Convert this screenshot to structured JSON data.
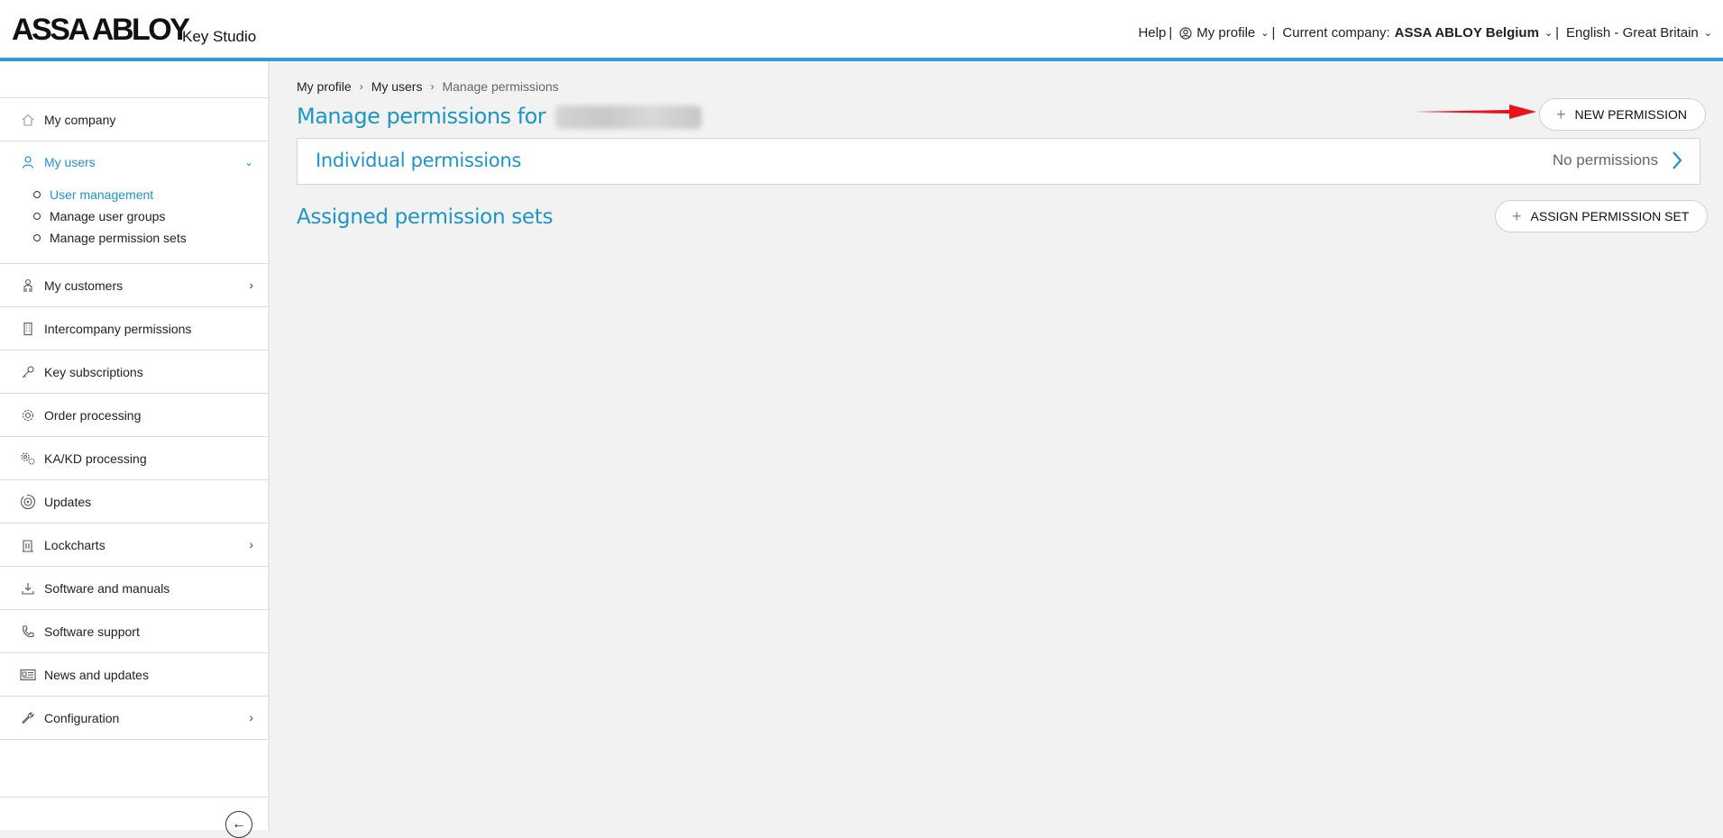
{
  "header": {
    "logo": "ASSA ABLOY",
    "product": "Key Studio",
    "help": "Help",
    "my_profile": "My profile",
    "company_label": "Current company:",
    "company_value": "ASSA ABLOY Belgium",
    "language": "English - Great Britain",
    "separator": "|"
  },
  "sidebar": {
    "items": [
      {
        "label": "My company",
        "icon": "home-icon"
      },
      {
        "label": "My users",
        "icon": "user-icon"
      },
      {
        "label": "My customers",
        "icon": "customer-icon"
      },
      {
        "label": "Intercompany permissions",
        "icon": "building-icon"
      },
      {
        "label": "Key subscriptions",
        "icon": "key-icon"
      },
      {
        "label": "Order processing",
        "icon": "gear-icon"
      },
      {
        "label": "KA/KD processing",
        "icon": "gears-icon"
      },
      {
        "label": "Updates",
        "icon": "updates-icon"
      },
      {
        "label": "Lockcharts",
        "icon": "lockchart-icon"
      },
      {
        "label": "Software and manuals",
        "icon": "download-icon"
      },
      {
        "label": "Software support",
        "icon": "phone-icon"
      },
      {
        "label": "News and updates",
        "icon": "news-icon"
      },
      {
        "label": "Configuration",
        "icon": "wrench-icon"
      }
    ],
    "my_users_sub": [
      "User management",
      "Manage user groups",
      "Manage permission sets"
    ]
  },
  "breadcrumb": [
    "My profile",
    "My users",
    "Manage permissions"
  ],
  "main": {
    "title": "Manage permissions for",
    "new_permission": "NEW PERMISSION",
    "individual_title": "Individual permissions",
    "individual_status": "No permissions",
    "assigned_title": "Assigned permission sets",
    "assign_button": "ASSIGN PERMISSION SET"
  },
  "colors": {
    "accent": "#1c95c9",
    "header_border": "#2a9fd0",
    "annotation_arrow": "#e8141c"
  }
}
